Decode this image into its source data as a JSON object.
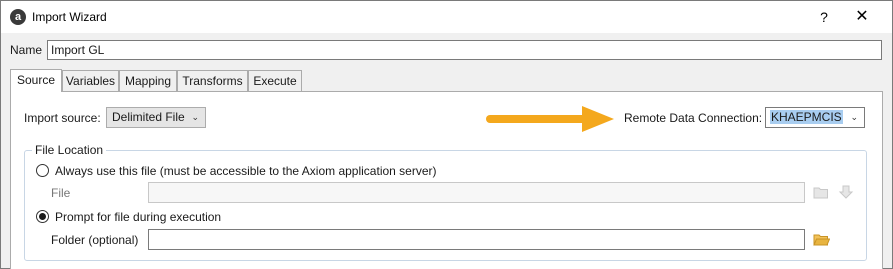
{
  "window": {
    "title": "Import Wizard",
    "app_icon_glyph": "a",
    "help_glyph": "?",
    "close_glyph": "✕"
  },
  "name": {
    "label": "Name",
    "value": "Import GL"
  },
  "tabs": [
    {
      "label": "Source",
      "active": true
    },
    {
      "label": "Variables",
      "active": false
    },
    {
      "label": "Mapping",
      "active": false
    },
    {
      "label": "Transforms",
      "active": false
    },
    {
      "label": "Execute",
      "active": false
    }
  ],
  "source": {
    "import_source_label": "Import source:",
    "import_source_value": "Delimited File",
    "remote_label": "Remote Data Connection:",
    "remote_value": "KHAEPMCIS",
    "chevron": "⌄"
  },
  "file_location": {
    "legend": "File Location",
    "option_always": "Always use this file (must be accessible to the Axiom application server)",
    "file_label": "File",
    "file_value": "",
    "option_prompt": "Prompt for file during execution",
    "folder_label": "Folder (optional)",
    "folder_value": ""
  },
  "colors": {
    "arrow": "#f4a81d",
    "selection": "#a8cdf0",
    "folder": "#e8b440"
  }
}
